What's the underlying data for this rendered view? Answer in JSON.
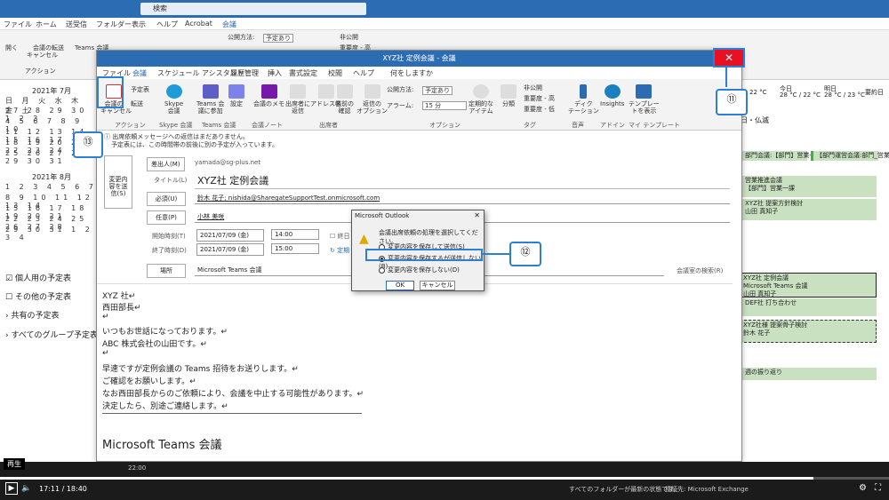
{
  "search": {
    "placeholder": "検索"
  },
  "bg_menu": [
    "ファイル",
    "ホーム",
    "送受信",
    "フォルダー",
    "表示",
    "ヘルプ",
    "Acrobat",
    "会議"
  ],
  "bg_ribbon": {
    "delete": "開く",
    "cancel": "会議の\nキャンセル",
    "forward": "転送",
    "teams": "Teams 会議",
    "action": "アクション",
    "teams_group": "Teams 会",
    "show_as_label": "公開方法:",
    "show_as_value": "予定あり",
    "private": "非公開",
    "importance": "重要度 - 高"
  },
  "calendar": {
    "month1": "2021年 7月",
    "days": "日 月 火 水 木 金 土",
    "rows1": [
      "27 28 29 30 1 2 3",
      "4 5 6 7 8 9 10",
      "11 12 13 14 15 16 17",
      "18 19 20 21 22 23 24",
      "25 26 27 28 29 30 31"
    ],
    "month2": "2021年 8月",
    "rows2": [
      "1 2 3 4 5 6 7",
      "8 9 10 11 12 13 14",
      "15 16 17 18 19 20 21",
      "22 23 24 25 26 27 28",
      "29 30 31 1 2 3 4"
    ]
  },
  "folders": [
    "個人用の予定表",
    "その他の予定表",
    "共有の予定表",
    "すべてのグループ予定表"
  ],
  "window": {
    "title": "XYZ社 定例会議 - 会議",
    "tabs": [
      "ファイル",
      "会議",
      "スケジュール アシスタント",
      "履歴管理",
      "挿入",
      "書式設定",
      "校閲",
      "ヘルプ",
      "何をしますか"
    ]
  },
  "ribbon": {
    "cancel": "会議の\nキャンセル",
    "copy": "予定表",
    "forward": "転送",
    "skype": "Skype\n会議",
    "teams": "Teams 会\n議に参加",
    "settings": "設定",
    "note": "会議のメモ",
    "attendee": "出席者に\n返信",
    "address": "アドレス帳",
    "names": "名前の\n確認",
    "options_resp": "返信の\nオプション",
    "show_as_label": "公開方法:",
    "show_as_value": "予定あり",
    "alarm_label": "アラーム:",
    "alarm_value": "15 分",
    "recurrence": "定期的な\nアイテム",
    "category": "分類",
    "private": "非公開",
    "high": "重要度 - 高",
    "low": "重要度 - 低",
    "dictate": "ディク\nテーション",
    "insights": "Insights",
    "template": "テンプレー\nトを表示",
    "groups": [
      "アクション",
      "Skype 会議",
      "Teams 会議",
      "会議ノート",
      "出席者",
      "オプション",
      "タグ",
      "音声",
      "アドイン",
      "マイ テンプレート"
    ]
  },
  "infobar": {
    "line1": "出席依頼メッセージへの返信はまだありません。",
    "line2": "予定表には、この時間帯の前後に別の予定が入っています。"
  },
  "form": {
    "send_update": "変更内\n容を送\n信(S)",
    "from_btn": "差出人(M)",
    "from_value": "yamada@sg-plus.net",
    "title_label": "タイトル(L)",
    "title_value": "XYZ社 定例会議",
    "required_btn": "必須(U)",
    "required_value": "鈴木 花子; nishida@SharegateSupportTest.onmicrosoft.com",
    "optional_btn": "任意(P)",
    "optional_value": "小林 美咲",
    "start_label": "開始時刻(T)",
    "start_date": "2021/07/09 (金)",
    "start_time": "14:00",
    "end_label": "終了時刻(D)",
    "end_date": "2021/07/09 (金)",
    "end_time": "15:00",
    "allday": "終日",
    "recurring": "定期",
    "location_btn": "場所",
    "location_value": "Microsoft Teams 会議",
    "room_finder": "会議室の検索(R)"
  },
  "body": [
    "XYZ 社↵",
    "西田部長↵",
    "↵",
    "いつもお世話になっております。↵",
    "ABC 株式会社の山田です。↵",
    "↵",
    "早速ですが定例会議の Teams 招待をお送りします。↵",
    "ご確認をお願いします。↵",
    "なお西田部長からのご依頼により、会議を中止する可能性があります。↵",
    "決定したら、別途ご連絡します。↵"
  ],
  "teams_heading": "Microsoft Teams 会議",
  "dialog": {
    "title": "Microsoft Outlook",
    "message": "会議出席依頼の処理を選択してください。",
    "opt1": "変更内容を保存して送信(S)",
    "opt2": "変更内容を保存するが送信しない(B)",
    "opt3": "変更内容を保存しない(D)",
    "ok": "OK",
    "cancel": "キャンセル"
  },
  "callouts": {
    "c11": "⑪",
    "c12": "⑫",
    "c13": "⑬"
  },
  "weather": {
    "temp1": "22 °C",
    "label2": "今日",
    "temp2": "28 °C / 22 °C",
    "label3": "明日",
    "temp3": "28 °C / 23 °C",
    "sel": "要約日"
  },
  "events": [
    "部門会議:【部門】営業一課",
    "【部門運営会議:部門_営業",
    "営業推進会議\n【部門】営業一課",
    "XYZ社 提案方針検討\n山田 真知子",
    "XYZ社 定例会議\nMicrosoft Teams 会議\n山田 真知子",
    "DEF社 打ち合わせ",
    "XYZ社様 提案骨子検討\n鈴木 花子",
    "週の振り返り"
  ],
  "right_header": "日・仏滅",
  "video": {
    "label": "再生",
    "time": "17:11 / 18:40",
    "status": "すべてのフォルダーが最新の状態です。",
    "conn": "接続先: Microsoft Exchange",
    "progress": 0.915
  },
  "time_slot": "22:00"
}
